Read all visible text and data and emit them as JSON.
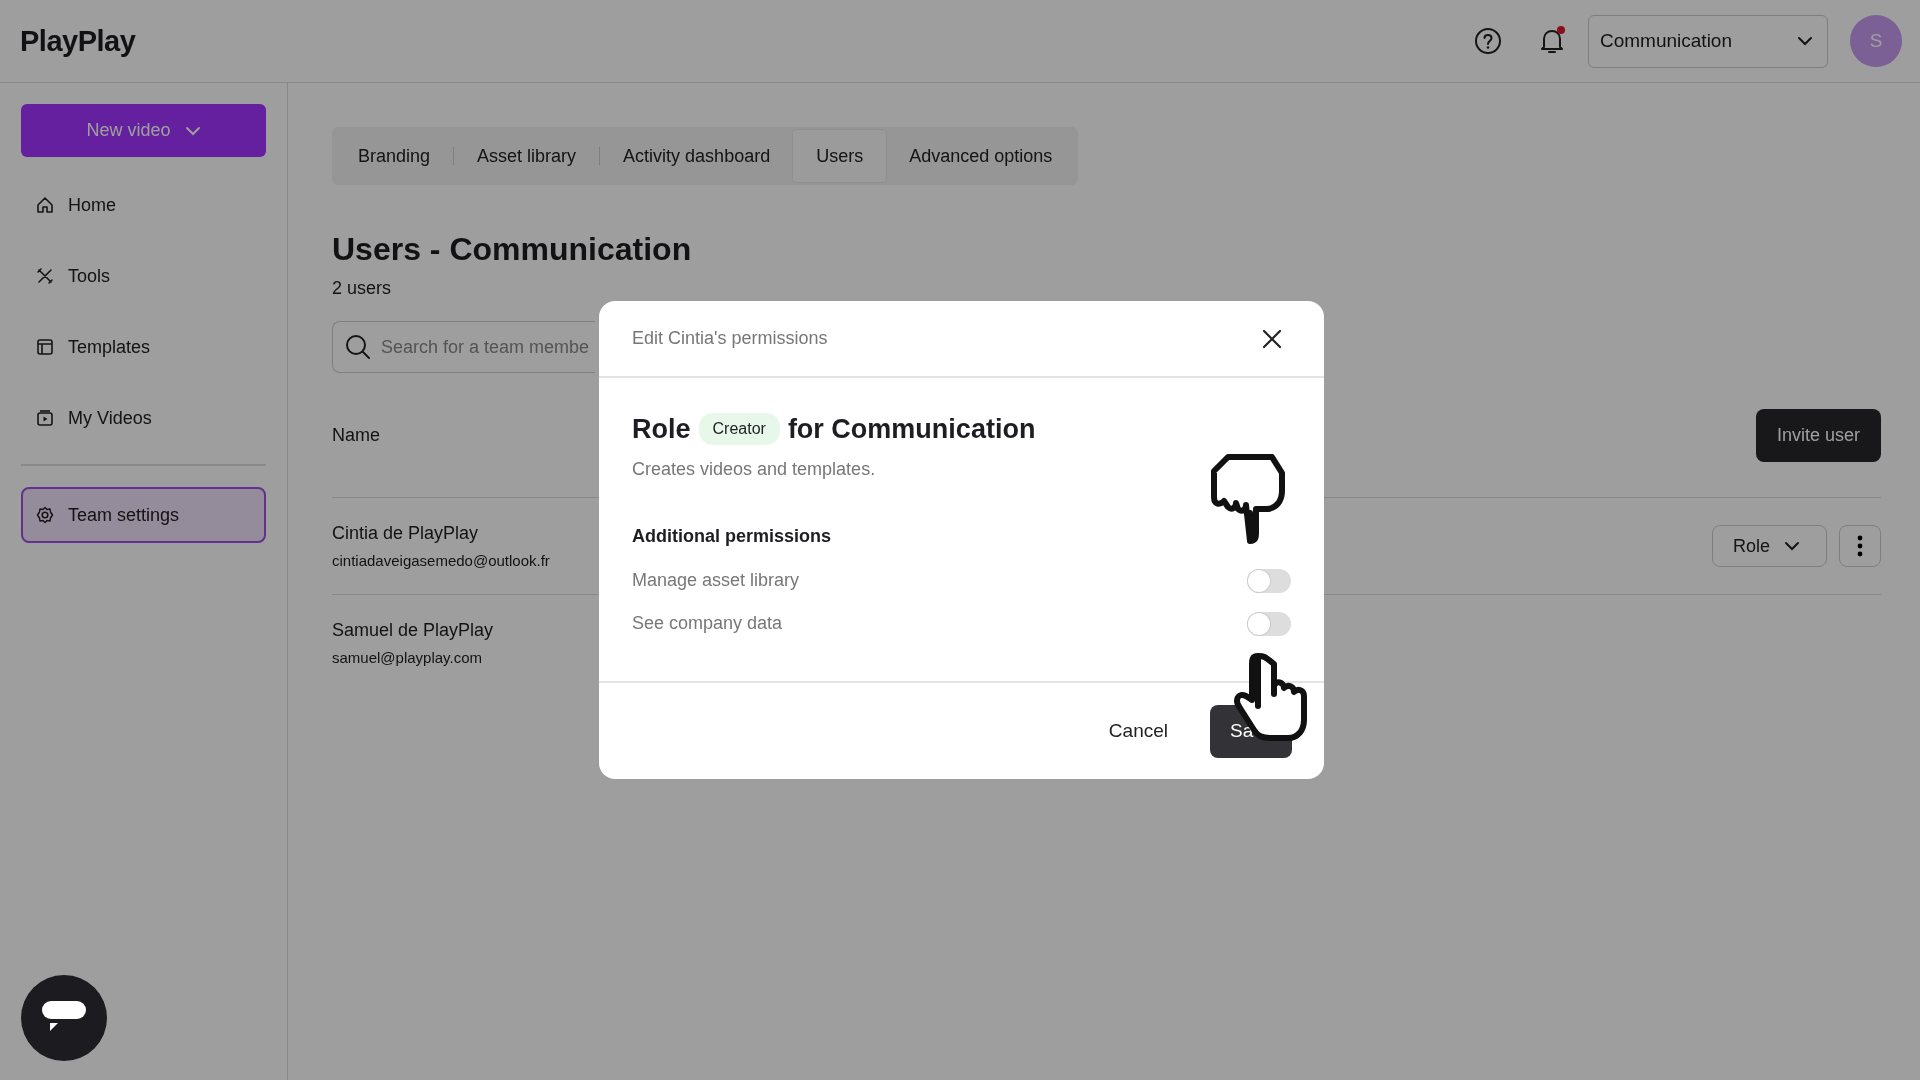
{
  "header": {
    "logo": "PlayPlay",
    "has_unread_notifications": true,
    "workspace": "Communication",
    "avatar": "S"
  },
  "sidebar": {
    "new_video": "New video",
    "items": [
      {
        "label": "Home",
        "kind": "home",
        "selected": false
      },
      {
        "label": "Tools",
        "kind": "tools",
        "selected": false
      },
      {
        "label": "Templates",
        "kind": "templates",
        "selected": false
      },
      {
        "label": "My Videos",
        "kind": "videos",
        "selected": false
      }
    ],
    "settings_item": {
      "label": "Team settings",
      "kind": "gear",
      "selected": true
    }
  },
  "tabs": [
    {
      "label": "Branding",
      "selected": false
    },
    {
      "label": "Asset library",
      "selected": false
    },
    {
      "label": "Activity dashboard",
      "selected": false
    },
    {
      "label": "Users",
      "selected": true
    },
    {
      "label": "Advanced options",
      "selected": false
    }
  ],
  "page": {
    "title": "Users - Communication",
    "count": "2 users",
    "search": {
      "placeholder": "Search for a team membe"
    }
  },
  "table": {
    "column": "Name",
    "invite_button": "Invite user",
    "rows": [
      {
        "name": "Cintia de PlayPlay",
        "email": "cintiadaveigasemedo@outlook.fr",
        "show_actions": true,
        "role_button": "Role"
      },
      {
        "name": "Samuel de PlayPlay",
        "email": "samuel@playplay.com",
        "show_actions": false
      }
    ]
  },
  "modal": {
    "title": "Edit Cintia's permissions",
    "role_prefix": "Role",
    "role_badge": "Creator",
    "role_suffix": "for Communication",
    "description": "Creates videos and templates.",
    "section": "Additional permissions",
    "permissions": [
      {
        "label": "Manage asset library",
        "on": false
      },
      {
        "label": "See company data",
        "on": false
      }
    ],
    "cancel": "Cancel",
    "save": "Sa"
  }
}
